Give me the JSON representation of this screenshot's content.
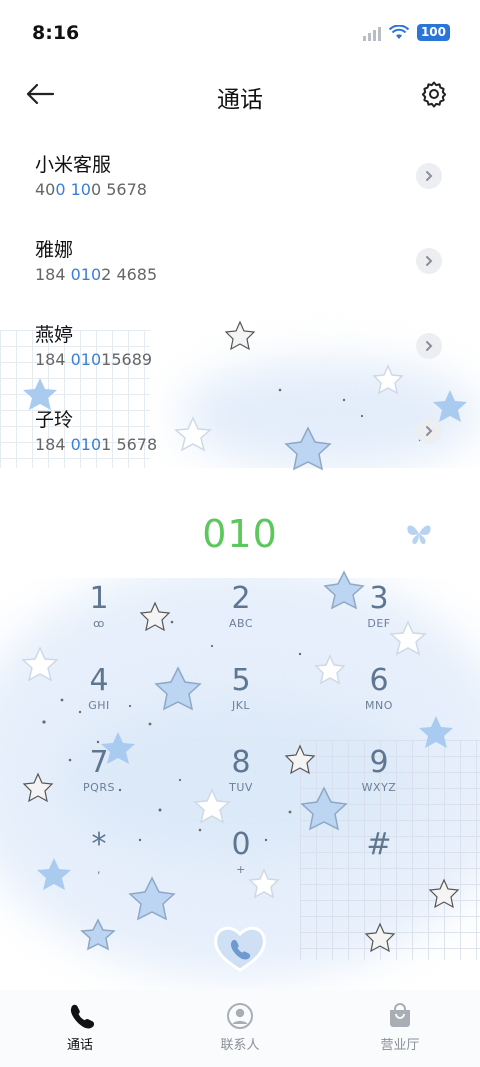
{
  "status_bar": {
    "time": "8:16",
    "battery": "100"
  },
  "header": {
    "title": "通话"
  },
  "recent_calls": [
    {
      "name": "小米客服",
      "number_parts": [
        "40",
        "0 10",
        "0 5678"
      ]
    },
    {
      "name": "雅娜",
      "number_parts": [
        "184 ",
        "010",
        "2 4685"
      ]
    },
    {
      "name": "燕婷",
      "number_parts": [
        "184 ",
        "010",
        "15689"
      ]
    },
    {
      "name": "子玲",
      "number_parts": [
        "184 ",
        "010",
        "1 5678"
      ]
    }
  ],
  "dialed_number": "010",
  "keypad": [
    {
      "digit": "1",
      "letters": "ꝏ"
    },
    {
      "digit": "2",
      "letters": "ABC"
    },
    {
      "digit": "3",
      "letters": "DEF"
    },
    {
      "digit": "4",
      "letters": "GHI"
    },
    {
      "digit": "5",
      "letters": "JKL"
    },
    {
      "digit": "6",
      "letters": "MNO"
    },
    {
      "digit": "7",
      "letters": "PQRS"
    },
    {
      "digit": "8",
      "letters": "TUV"
    },
    {
      "digit": "9",
      "letters": "WXYZ"
    },
    {
      "digit": "*",
      "letters": ","
    },
    {
      "digit": "0",
      "letters": "+"
    },
    {
      "digit": "#",
      "letters": ""
    }
  ],
  "bottom_nav": [
    {
      "label": "通话",
      "icon": "phone-icon",
      "active": true
    },
    {
      "label": "联系人",
      "icon": "contacts-icon",
      "active": false
    },
    {
      "label": "营业厅",
      "icon": "bag-icon",
      "active": false
    }
  ],
  "colors": {
    "accent": "#3a7fd6",
    "dial_green": "#5ac85a",
    "key_text": "#5f7691"
  }
}
